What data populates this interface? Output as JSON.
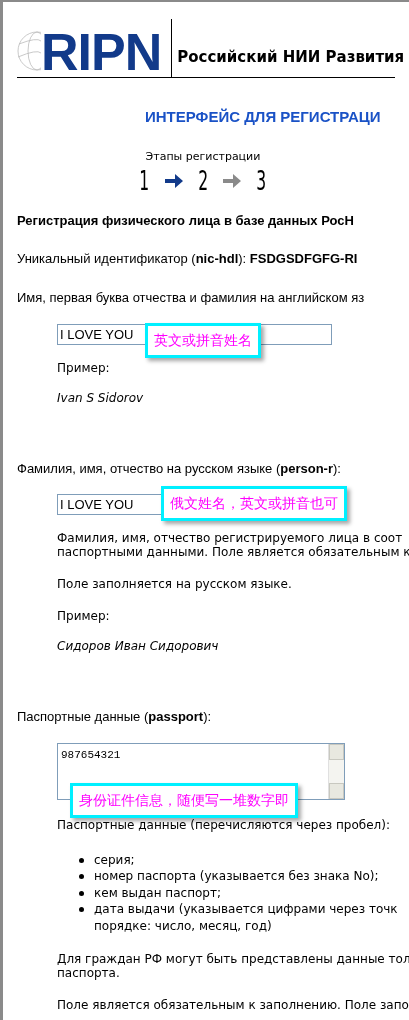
{
  "header": {
    "logo": "RIPN",
    "title": "Российский НИИ Развития"
  },
  "page_title": "ИНТЕРФЕЙС ДЛЯ РЕГИСТРАЦИ",
  "stages": {
    "label": "Этапы регистрации",
    "steps": [
      {
        "label": "1"
      },
      {
        "label": "2"
      },
      {
        "label": "3"
      }
    ],
    "arrows": [
      {
        "active": true
      },
      {
        "active": false
      }
    ]
  },
  "heading": "Регистрация физического лица в базе данных РосН",
  "blocks": [
    {
      "kind": "label",
      "text": "Уникальный идентификатор (**nic-hdl**): **FSDGSDFGFG-RI**"
    },
    {
      "kind": "label",
      "text": "Имя, первая буква отчества и фамилия на английском яз"
    },
    {
      "kind": "input",
      "value": "I LOVE YOU",
      "note": "英文或拼音姓名"
    },
    {
      "kind": "hint",
      "lines": [
        "Пример:"
      ]
    },
    {
      "kind": "example",
      "text": "Ivan S Sidorov"
    },
    {
      "kind": "label",
      "text": "Фамилия, имя, отчество на русском языке (**person-r**):"
    },
    {
      "kind": "input",
      "value": "I LOVE YOU",
      "note": "俄文姓名，英文或拼音也可"
    },
    {
      "kind": "hint",
      "lines": [
        "Фамилия, имя, отчество регистрируемого лица в соот",
        "паспортными данными. Поле является обязательным к"
      ]
    },
    {
      "kind": "hint",
      "lines": [
        "Поле заполняется на русском языке."
      ]
    },
    {
      "kind": "hint",
      "lines": [
        "Пример:"
      ]
    },
    {
      "kind": "example",
      "text": "Сидоров Иван Сидорович"
    },
    {
      "kind": "label",
      "text": "Паспортные данные (**passport**):"
    },
    {
      "kind": "textarea",
      "value": "987654321",
      "note": "身份证件信息，随便写一堆数字即"
    },
    {
      "kind": "hint",
      "lines": [
        "Паспортные данные (перечисляются через пробел):"
      ]
    },
    {
      "kind": "bullets",
      "items": [
        [
          "серия;"
        ],
        [
          "номер паспорта (указывается без знака No);"
        ],
        [
          "кем выдан паспорт;"
        ],
        [
          "дата выдачи (указывается цифрами через точк",
          "порядке: число, месяц, год)"
        ]
      ]
    },
    {
      "kind": "hint",
      "lines": [
        "Для граждан РФ могут быть представлены данные тол",
        "паспорта."
      ]
    },
    {
      "kind": "hint",
      "lines": [
        "Поле является обязательным к заполнению. Поле запо"
      ]
    }
  ]
}
